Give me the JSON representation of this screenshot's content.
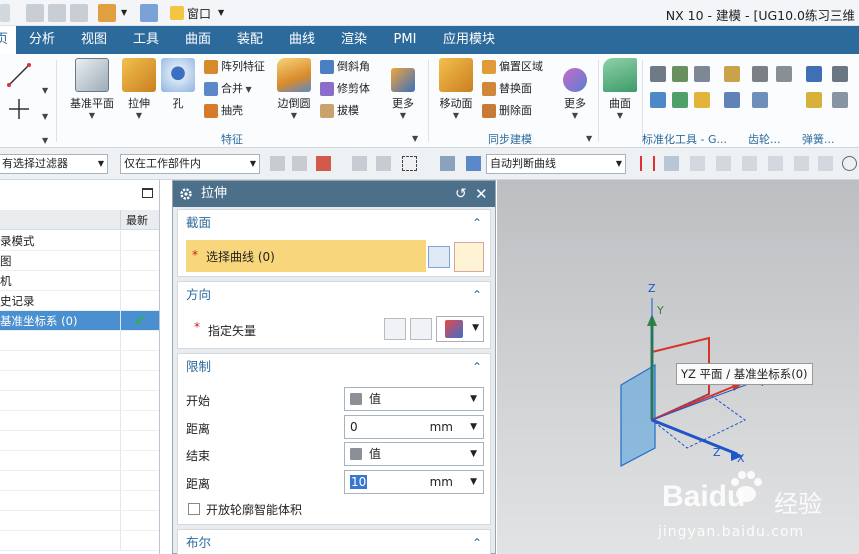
{
  "window": {
    "title": "NX 10 - 建模 - [UG10.0练习三维",
    "quick_menu": "窗口"
  },
  "menu_tabs": [
    "主页",
    "分析",
    "视图",
    "工具",
    "曲面",
    "装配",
    "曲线",
    "渲染",
    "PMI",
    "应用模块"
  ],
  "ribbon": {
    "feature_group": {
      "datum_plane": "基准平面",
      "extrude": "拉伸",
      "hole": "孔",
      "pattern_feature": "阵列特征",
      "unite": "合并",
      "shell": "抽壳",
      "edge_blend": "边倒圆",
      "chamfer": "倒斜角",
      "trim_body": "修剪体",
      "draft": "拔模",
      "more": "更多",
      "label": "特征"
    },
    "sync_group": {
      "move_face": "移动面",
      "offset_region": "偏置区域",
      "replace_face": "替换面",
      "delete_face": "删除面",
      "more": "更多",
      "label": "同步建模"
    },
    "surface_group": {
      "surface": "曲面"
    },
    "right_labels": {
      "standard_tools": "标准化工具 - G...",
      "gear": "齿轮...",
      "spring": "弹簧..."
    }
  },
  "selection_bar": {
    "filter": "有选择过滤器",
    "scope": "仅在工作部件内",
    "curve_rule": "自动判断曲线"
  },
  "navigator": {
    "column_latest": "最新",
    "rows": [
      {
        "name": "录模式",
        "check": ""
      },
      {
        "name": "图",
        "check": ""
      },
      {
        "name": "机",
        "check": ""
      },
      {
        "name": "史记录",
        "check": ""
      },
      {
        "name": "基准坐标系 (0)",
        "check": "✔"
      }
    ]
  },
  "dialog": {
    "title": "拉伸",
    "section": {
      "header": "截面",
      "select_curve": "选择曲线 (0)"
    },
    "direction": {
      "header": "方向",
      "specify_vector": "指定矢量"
    },
    "limits": {
      "header": "限制",
      "start_label": "开始",
      "start_value": "值",
      "distance_label": "距离",
      "start_distance": "0",
      "unit": "mm",
      "end_label": "结束",
      "end_value": "值",
      "end_distance": "10",
      "open_profile": "开放轮廓智能体积"
    },
    "boolean": {
      "header": "布尔"
    }
  },
  "viewport": {
    "tooltip": "YZ 平面 / 基准坐标系(0)",
    "axis_labels": {
      "z_top": "Z",
      "y_top": "Y",
      "y_right": "Y",
      "z_bottom": "Z",
      "x_bottom": "X"
    },
    "colors": {
      "green_axis": "#2e8b2e",
      "blue_axis": "#1f55c9",
      "red_axis": "#d6332a",
      "plane_fill": "#4f9fe0"
    }
  },
  "watermark": {
    "brand": "Baidu",
    "subtitle": "经验",
    "url": "jingyan.baidu.com"
  }
}
